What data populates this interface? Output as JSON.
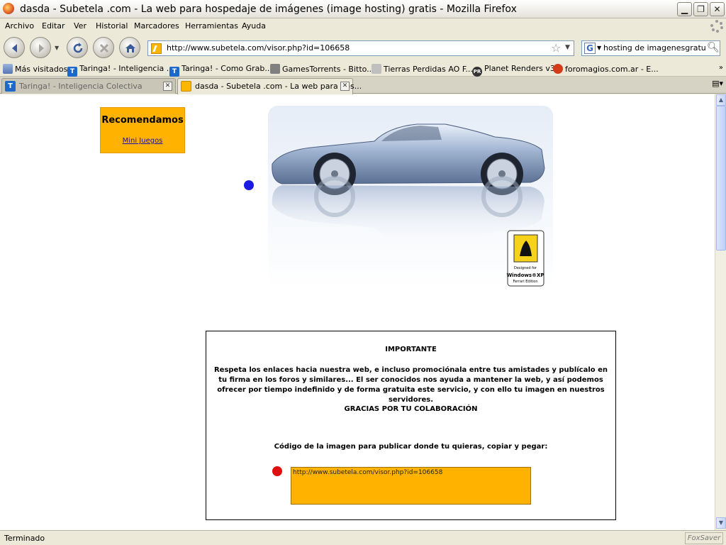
{
  "window": {
    "title": "dasda - Subetela .com - La web para hospedaje de imágenes (image hosting) gratis - Mozilla Firefox"
  },
  "menu": [
    "Archivo",
    "Editar",
    "Ver",
    "Historial",
    "Marcadores",
    "Herramientas",
    "Ayuda"
  ],
  "nav": {
    "url": "http://www.subetela.com/visor.php?id=106658",
    "search_query": "hosting de imagenesgratuitos"
  },
  "bookmarks": [
    "Más visitados",
    "Taringa! - Inteligencia ...",
    "Taringa! - Como Grab...",
    "GamesTorrents - Bitto...",
    "Tierras Perdidas AO F...",
    "Planet Renders v3",
    "foromagios.com.ar - E..."
  ],
  "bookmark_icon_text": {
    "taringa": "T",
    "planet_renders": "PR"
  },
  "tabs": [
    {
      "label": "Taringa! - Inteligencia Colectiva",
      "active": false
    },
    {
      "label": "dasda - Subetela .com - La web para hos...",
      "active": true
    }
  ],
  "page": {
    "recommend_title": "Recomendamos",
    "recommend_link": "Mini Juegos",
    "badge": {
      "line1": "Designed for",
      "line2": "Windows®XP",
      "line3": "Ferrari Edition"
    },
    "important_title": "IMPORTANTE",
    "important_message": "Respeta los enlaces hacia nuestra web, e incluso promociónala entre tus amistades y publícalo en tu firma en los foros y similares... El ser conocidos nos ayuda a mantener la web, y así podemos ofrecer por tiempo indefinido y de forma gratuita este servicio, y con ello tu imagen en nuestros servidores.",
    "thanks": "GRACIAS POR TU COLABORACIÓN",
    "code_label": "Código de la imagen para publicar donde tu quieras, copiar y pegar:",
    "code_value": "http://www.subetela.com/visor.php?id=106658"
  },
  "status": {
    "text": "Terminado",
    "addon": "FoxSaver"
  },
  "colors": {
    "accent_orange": "#ffb300",
    "dot_blue": "#1a1ae0",
    "dot_red": "#e01010"
  }
}
